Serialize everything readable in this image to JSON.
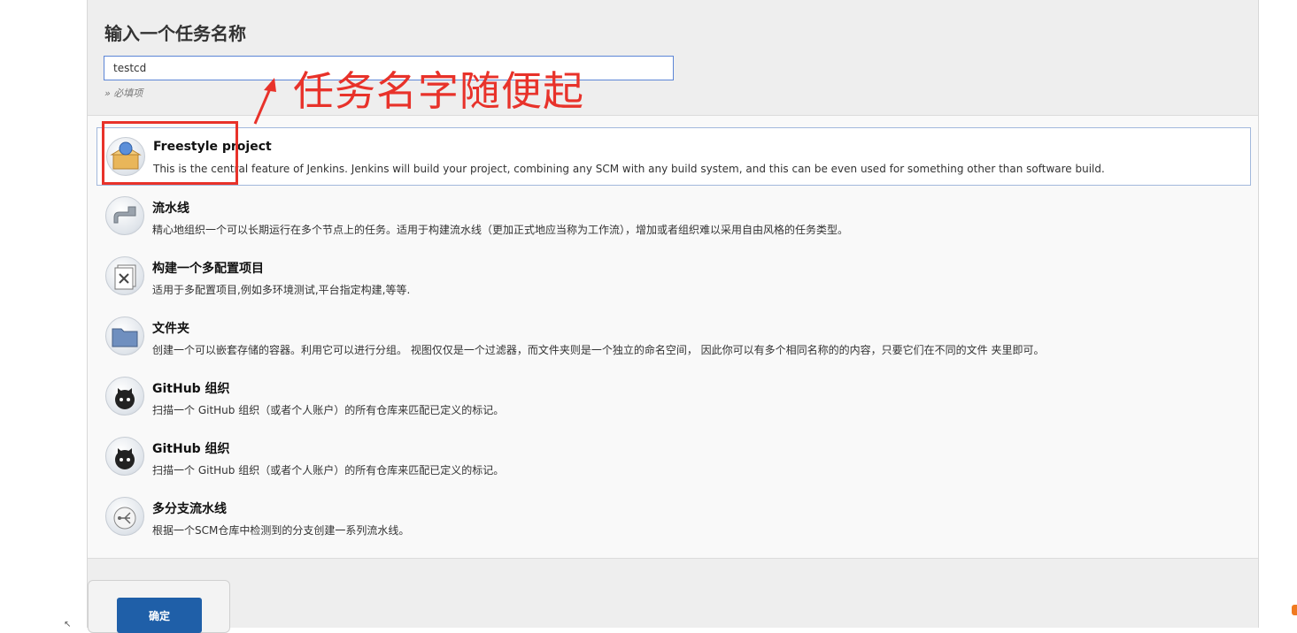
{
  "header": {
    "title": "输入一个任务名称"
  },
  "name_field": {
    "value": "testcd",
    "required_note": "» 必填项"
  },
  "items": [
    {
      "title": "Freestyle project",
      "description": "This is the central feature of Jenkins. Jenkins will build your project, combining any SCM with any build system, and this can be even used for something other than software build.",
      "icon": "freestyle-box-icon",
      "selected": true
    },
    {
      "title": "流水线",
      "description": "精心地组织一个可以长期运行在多个节点上的任务。适用于构建流水线（更加正式地应当称为工作流），增加或者组织难以采用自由风格的任务类型。",
      "icon": "pipeline-icon"
    },
    {
      "title": "构建一个多配置项目",
      "description": "适用于多配置项目,例如多环境测试,平台指定构建,等等.",
      "icon": "multi-config-icon"
    },
    {
      "title": "文件夹",
      "description": "创建一个可以嵌套存储的容器。利用它可以进行分组。 视图仅仅是一个过滤器，而文件夹则是一个独立的命名空间， 因此你可以有多个相同名称的的内容，只要它们在不同的文件 夹里即可。",
      "icon": "folder-icon"
    },
    {
      "title": "GitHub 组织",
      "description": "扫描一个 GitHub 组织（或者个人账户）的所有仓库来匹配已定义的标记。",
      "icon": "github-icon"
    },
    {
      "title": "GitHub 组织",
      "description": "扫描一个 GitHub 组织（或者个人账户）的所有仓库来匹配已定义的标记。",
      "icon": "github-icon"
    },
    {
      "title": "多分支流水线",
      "description": "根据一个SCM仓库中检测到的分支创建一系列流水线。",
      "icon": "multibranch-icon"
    }
  ],
  "footer": {
    "ok_label": "确定"
  },
  "annotation": {
    "text": "任务名字随便起",
    "color": "#e8322a"
  }
}
